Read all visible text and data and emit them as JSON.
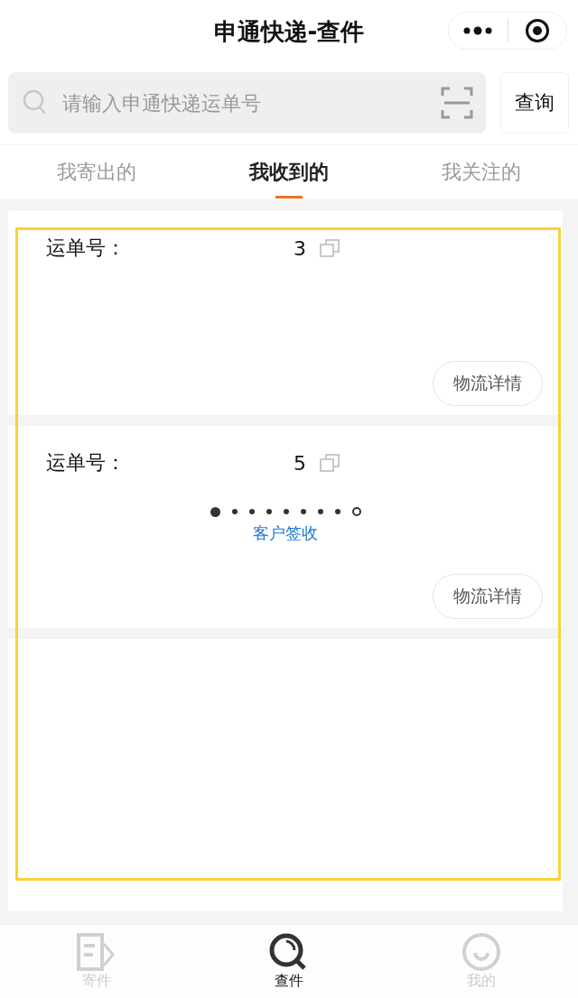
{
  "header": {
    "title": "申通快递-查件"
  },
  "search": {
    "placeholder": "请输入申通快递运单号",
    "button": "查询"
  },
  "tabs": [
    {
      "label": "我寄出的",
      "selected": false
    },
    {
      "label": "我收到的",
      "selected": true
    },
    {
      "label": "我关注的",
      "selected": false
    }
  ],
  "orders": [
    {
      "label": "运单号：",
      "number": "3",
      "details_button": "物流详情"
    },
    {
      "label": "运单号：",
      "number": "5",
      "progress": [
        {
          "kind": "current"
        },
        {
          "kind": "step"
        },
        {
          "kind": "step"
        },
        {
          "kind": "step"
        },
        {
          "kind": "step"
        },
        {
          "kind": "step"
        },
        {
          "kind": "step"
        },
        {
          "kind": "step"
        },
        {
          "kind": "end"
        }
      ],
      "status": "客户签收",
      "details_button": "物流详情"
    }
  ],
  "bottom_nav": [
    {
      "label": "寄件",
      "kind": "send",
      "selected": false
    },
    {
      "label": "查件",
      "kind": "search",
      "selected": true
    },
    {
      "label": "我的",
      "kind": "profile",
      "selected": false
    }
  ]
}
